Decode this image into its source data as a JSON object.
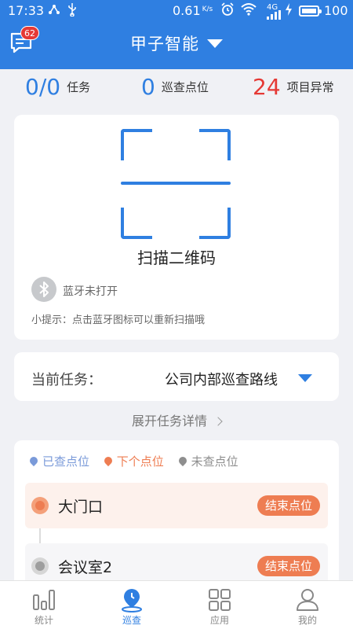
{
  "status_bar": {
    "time": "17:33",
    "speed": "0.61",
    "speed_unit": "K/s",
    "network": "4G",
    "battery_level": "100",
    "battery_fraction": 1.0
  },
  "header": {
    "title": "甲子智能",
    "message_badge": "62",
    "bg_color": "#2f7fe1"
  },
  "stats": {
    "tasks_value": "0/0",
    "tasks_label": "任务",
    "points_value": "0",
    "points_label": "巡查点位",
    "anomalies_value": "24",
    "anomalies_label": "项目异常"
  },
  "scan": {
    "label": "扫描二维码",
    "bluetooth_status": "蓝牙未打开",
    "tip": "小提示：点击蓝牙图标可以重新扫描哦"
  },
  "task": {
    "label": "当前任务：",
    "value": "公司内部巡查路线",
    "expand_label": "展开任务详情"
  },
  "legend": {
    "checked": "已查点位",
    "next": "下个点位",
    "unchecked": "未查点位",
    "colors": {
      "checked": "#7a9ad9",
      "next": "#ee7d52",
      "unchecked": "#8e8e8e"
    }
  },
  "points": [
    {
      "name": "大门口",
      "action": "结束点位",
      "state": "next"
    },
    {
      "name": "会议室2",
      "action": "结束点位",
      "state": "unchecked"
    }
  ],
  "bottom_nav": {
    "items": [
      {
        "label": "统计",
        "icon": "bar-chart-icon"
      },
      {
        "label": "巡查",
        "icon": "patrol-clock-pin-icon",
        "active": true
      },
      {
        "label": "应用",
        "icon": "grid-apps-icon"
      },
      {
        "label": "我的",
        "icon": "user-profile-icon"
      }
    ],
    "accent": "#2f7fe1"
  }
}
